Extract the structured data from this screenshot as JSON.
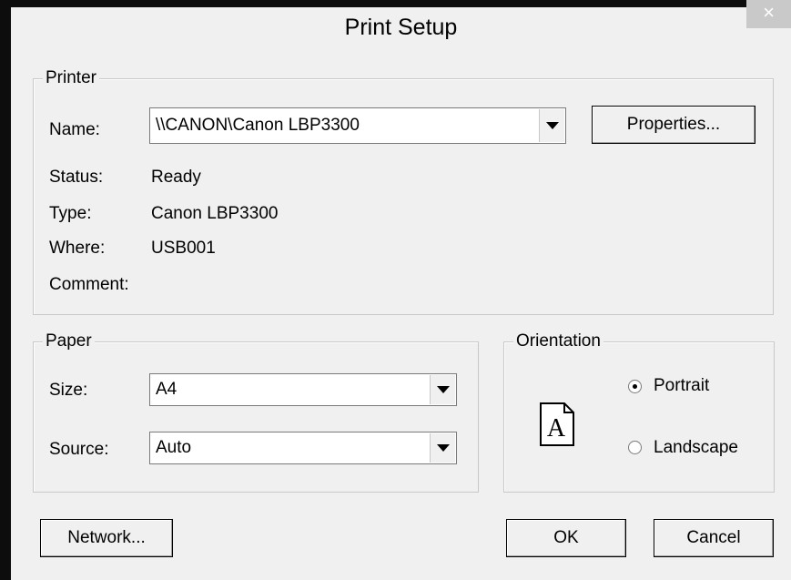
{
  "window": {
    "title": "Print Setup",
    "close_glyph": "×"
  },
  "printer": {
    "legend": "Printer",
    "name_label": "Name:",
    "name_value": "\\\\CANON\\Canon LBP3300",
    "properties_label": "Properties...",
    "status_label": "Status:",
    "status_value": "Ready",
    "type_label": "Type:",
    "type_value": "Canon LBP3300",
    "where_label": "Where:",
    "where_value": "USB001",
    "comment_label": "Comment:"
  },
  "paper": {
    "legend": "Paper",
    "size_label": "Size:",
    "size_value": "A4",
    "source_label": "Source:",
    "source_value": "Auto"
  },
  "orientation": {
    "legend": "Orientation",
    "portrait_label": "Portrait",
    "landscape_label": "Landscape",
    "selected": "Portrait",
    "preview_letter": "A"
  },
  "buttons": {
    "network_label": "Network...",
    "ok_label": "OK",
    "cancel_label": "Cancel"
  },
  "icons": {
    "close": "close-icon",
    "dropdown": "chevron-down-icon",
    "page": "page-portrait-icon"
  }
}
